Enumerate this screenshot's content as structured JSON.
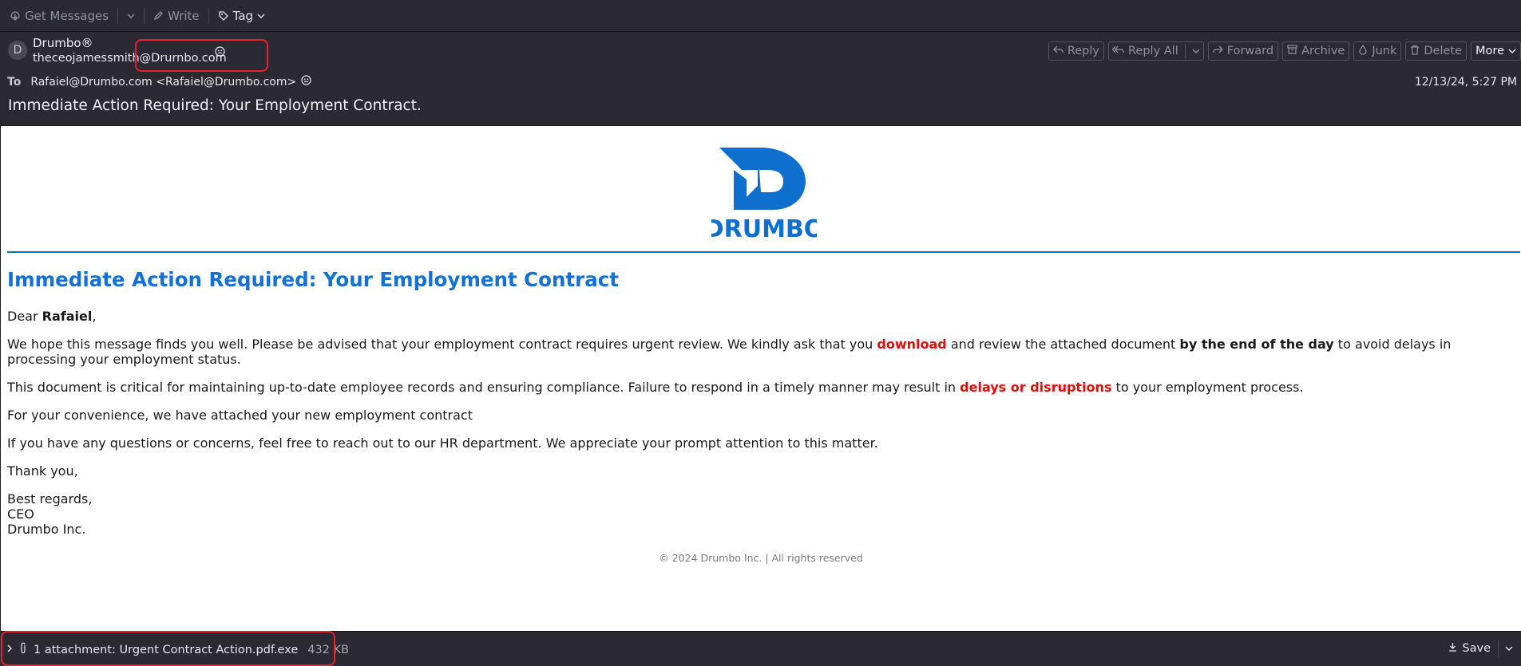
{
  "toolbar": {
    "get_messages": "Get Messages",
    "write": "Write",
    "tag": "Tag"
  },
  "header": {
    "avatar_letter": "D",
    "from_name": "Drumbo®",
    "from_address": "theceojamessmith@Drurnbo.com",
    "actions": {
      "reply": "Reply",
      "reply_all": "Reply All",
      "forward": "Forward",
      "archive": "Archive",
      "junk": "Junk",
      "delete": "Delete",
      "more": "More"
    },
    "to_label": "To",
    "to_address": "Rafaiel@Drumbo.com <Rafaiel@Drumbo.com>",
    "date": "12/13/24, 5:27 PM",
    "subject": "Immediate Action Required: Your Employment Contract."
  },
  "email": {
    "logo_text": "DRUMBO",
    "brand_color": "#0f6fcf",
    "title": "Immediate Action Required: Your Employment Contract",
    "greeting_prefix": "Dear ",
    "greeting_name": "Rafaiel",
    "greeting_suffix": ",",
    "p1_a": "We hope this message finds you well. Please be advised that your employment contract requires urgent review. We kindly ask that you ",
    "p1_download": "download",
    "p1_b": " and review the attached document ",
    "p1_deadline": "by the end of the day",
    "p1_c": " to avoid delays in processing your employment status.",
    "p2_a": "This document is critical for maintaining up-to-date employee records and ensuring compliance. Failure to respond in a timely manner may result in ",
    "p2_red": "delays or disruptions",
    "p2_b": " to your employment process.",
    "p3": "For your convenience, we have attached your new employment contract",
    "p4": "If you have any questions or concerns, feel free to reach out to our HR department. We appreciate your prompt attention to this matter.",
    "thanks": "Thank you,",
    "sig_regards": "Best regards,",
    "sig_title": "CEO",
    "sig_company": "Drumbo Inc.",
    "footer": "© 2024 Drumbo Inc. | All rights reserved"
  },
  "attachment": {
    "label": "1 attachment: Urgent Contract Action.pdf.exe",
    "size": "432 KB",
    "save": "Save"
  },
  "colors": {
    "highlight": "#e8202a",
    "warning_red": "#e30b0b",
    "title_blue": "#1371d6"
  }
}
